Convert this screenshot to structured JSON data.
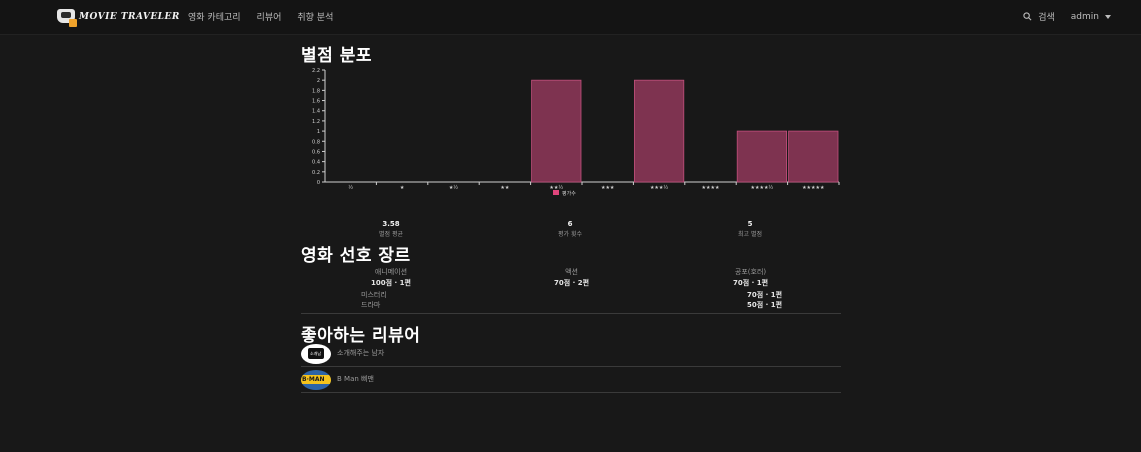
{
  "navbar": {
    "brand": "MOVIE TRAVELER",
    "links": [
      "영화 카테고리",
      "리뷰어",
      "취향 분석"
    ],
    "search_label": "검색",
    "user_label": "admin"
  },
  "rating_section": {
    "title": "별점 분포",
    "stats": [
      {
        "value": "3.58",
        "label": "별점 평균"
      },
      {
        "value": "6",
        "label": "평가 횟수"
      },
      {
        "value": "5",
        "label": "최고 별점"
      }
    ]
  },
  "chart_data": {
    "type": "bar",
    "categories": [
      "½",
      "★",
      "★½",
      "★★",
      "★★½",
      "★★★",
      "★★★½",
      "★★★★",
      "★★★★½",
      "★★★★★"
    ],
    "series": [
      {
        "name": "평가수",
        "values": [
          0,
          0,
          0,
          0,
          2,
          0,
          2,
          0,
          1,
          1
        ]
      }
    ],
    "ylim": [
      0,
      2.2
    ],
    "yticks": [
      "0",
      "0.2",
      "0.4",
      "0.6",
      "0.8",
      "1",
      "1.2",
      "1.4",
      "1.6",
      "1.8",
      "2",
      "2.2"
    ],
    "bar_color": "#7e3350",
    "bar_edge_color": "#c2507c",
    "legend_color": "#e0457b",
    "legend_position": "bottom-center",
    "grid": false
  },
  "genre_section": {
    "title": "영화 선호 장르",
    "top": [
      {
        "name": "애니메이션",
        "score": "100점 · 1편"
      },
      {
        "name": "액션",
        "score": "70점 · 2편"
      },
      {
        "name": "공포(호러)",
        "score": "70점 · 1편"
      }
    ],
    "rest": [
      {
        "name": "미스터리",
        "score": "70점 · 1편"
      },
      {
        "name": "드라마",
        "score": "50점 · 1편"
      }
    ]
  },
  "reviewer_section": {
    "title": "좋아하는 리뷰어",
    "reviewers": [
      {
        "name": "소개해주는 남자",
        "avatar_text": "소개남"
      },
      {
        "name": "B Man 삐맨",
        "avatar_text": "B·MAN"
      }
    ]
  }
}
